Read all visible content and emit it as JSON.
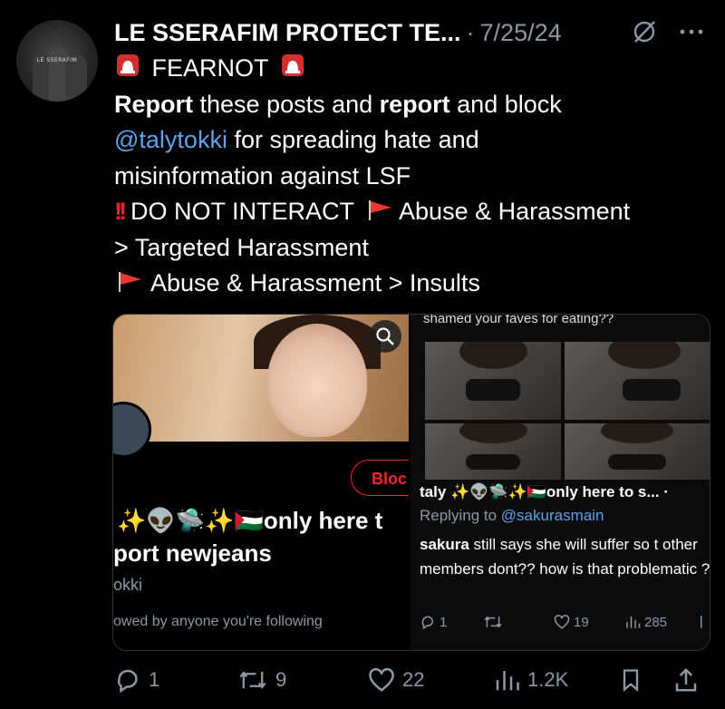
{
  "author": {
    "avatar_label": "LE SSERAFIM",
    "name": "LE SSERAFIM PROTECT TE...",
    "separator": "·",
    "date": "7/25/24"
  },
  "post": {
    "line1": "FEARNOT",
    "line2_a": "Report",
    "line2_b": " these posts and ",
    "line2_c": "report",
    "line2_d": " and block",
    "line3_mention": "@talytokki",
    "line3_rest": " for spreading hate and",
    "line4": "misinformation against LSF",
    "line5_a": "DO NOT INTERACT",
    "line5_b": "Abuse & Harassment",
    "line6": "> Targeted Harassment",
    "line7": "Abuse & Harassment > Insults"
  },
  "media_left": {
    "block_label": "Bloc",
    "display_name": "✨👽🛸✨🇵🇸only here t",
    "bio": "port newjeans",
    "handle": "okki",
    "followed": "owed by anyone you're following"
  },
  "media_right": {
    "caption": "shamed your faves for eating??",
    "name": "taly ✨👽🛸✨🇵🇸only here to s... ·",
    "reply_prefix": "Replying to ",
    "reply_mention": "@sakurasmain",
    "text_bold": "sakura",
    "text_rest": " still says she will suffer so t other members dont?? how is that problematic ??",
    "replies": "1",
    "likes": "19",
    "views": "285"
  },
  "actions": {
    "replies": "1",
    "reposts": "9",
    "likes": "22",
    "views": "1.2K"
  },
  "colors": {
    "accent": "#5ea3ea",
    "danger": "#f4212e",
    "muted": "#8b98a5"
  }
}
